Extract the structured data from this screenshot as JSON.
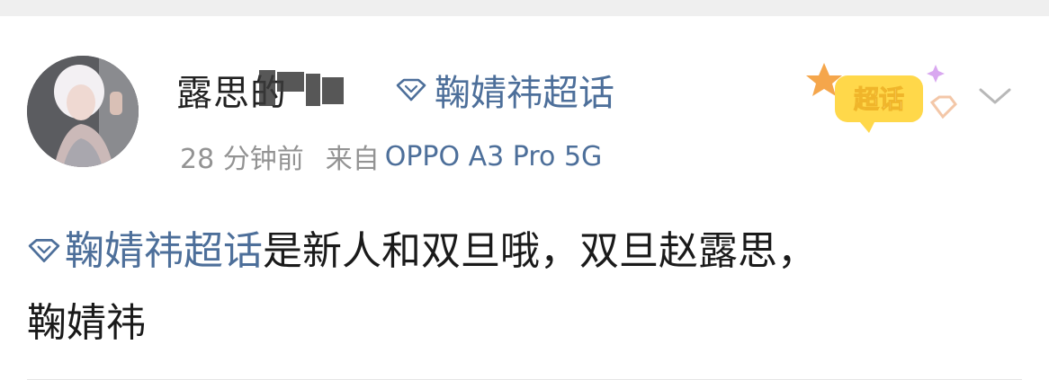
{
  "post": {
    "author_name": "露思的",
    "super_topic": "鞠婧祎超话",
    "time_ago": "28 分钟前",
    "source_prefix": "来自",
    "device": "OPPO A3 Pro 5G",
    "badge_label": "超话",
    "content": {
      "hashtag": "鞠婧祎超话",
      "line1_rest": "是新人和双旦哦，双旦赵露思，",
      "line2": "鞠婧祎"
    }
  },
  "icons": {
    "topic": "diamond-icon",
    "badge": "super-topic-badge-icon",
    "more": "chevron-down-icon"
  },
  "colors": {
    "link": "#4d6f9a",
    "meta": "#939393",
    "text": "#1a1a1a",
    "badge_yellow": "#ffd84a"
  }
}
